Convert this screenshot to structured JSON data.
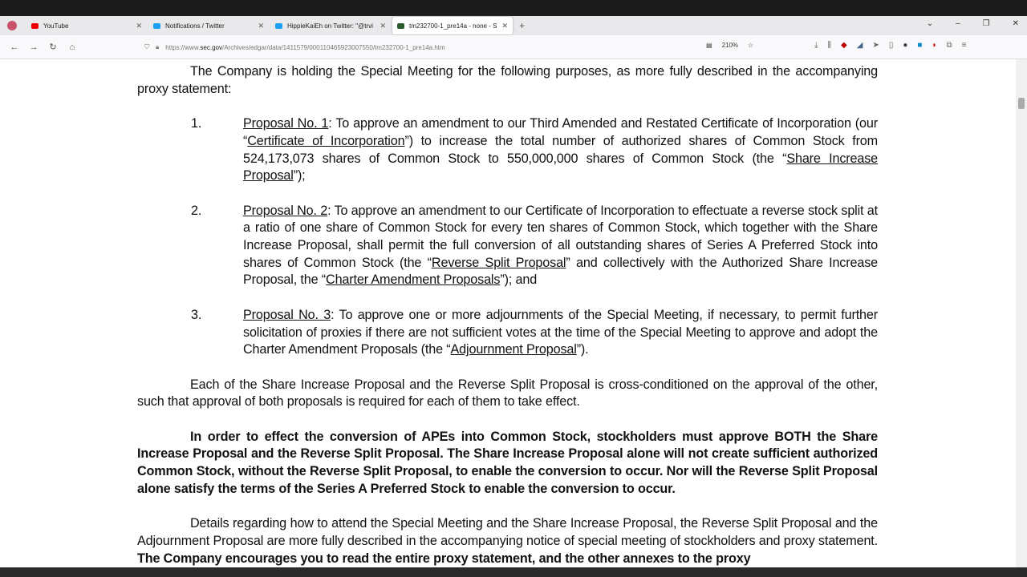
{
  "browser": {
    "tabs": [
      {
        "label": "YouTube",
        "icon": "youtube-icon",
        "color": "#e00"
      },
      {
        "label": "Notifications / Twitter",
        "icon": "twitter-icon",
        "color": "#1da1f2"
      },
      {
        "label": "HippieKaiEh on Twitter: \"@trvi",
        "icon": "twitter-icon",
        "color": "#1da1f2"
      },
      {
        "label": "tm232700-1_pre14a - none - S",
        "icon": "sec-icon",
        "color": "#2a5a2a",
        "active": true
      }
    ],
    "url_prefix": "https://www.",
    "url_domain": "sec.gov",
    "url_path": "/Archives/edgar/data/1411579/000110465923007550/tm232700-1_pre14a.htm",
    "zoom": "210%"
  },
  "document": {
    "paragraphs": [
      {
        "type": "para",
        "indent": true,
        "segs": [
          {
            "t": "The Company is holding the Special Meeting for the following purposes, as more fully described in the accompanying proxy statement:"
          }
        ]
      },
      {
        "type": "item",
        "num": "1.",
        "segs": [
          {
            "t": "Proposal No. 1",
            "u": true
          },
          {
            "t": ": To approve an amendment to our Third Amended and Restated Certificate of Incorporation (our “"
          },
          {
            "t": "Certificate of Incorporation",
            "u": true
          },
          {
            "t": "”) to increase the total number of authorized shares of Common Stock from 524,173,073 shares of Common Stock to 550,000,000 shares of Common Stock (the “"
          },
          {
            "t": "Share Increase Proposal",
            "u": true
          },
          {
            "t": "”);"
          }
        ]
      },
      {
        "type": "item",
        "num": "2.",
        "segs": [
          {
            "t": "Proposal No. 2",
            "u": true
          },
          {
            "t": ": To approve an amendment to our Certificate of Incorporation to effectuate a reverse stock split at a ratio of one share of Common Stock for every ten shares of Common Stock, which together with the Share Increase Proposal, shall permit the full conversion of all outstanding shares of Series A Preferred Stock into shares of Common Stock (the “"
          },
          {
            "t": "Reverse Split Proposal",
            "u": true
          },
          {
            "t": "” and collectively with the Authorized Share Increase Proposal, the “"
          },
          {
            "t": "Charter Amendment Proposals",
            "u": true
          },
          {
            "t": "”); and"
          }
        ]
      },
      {
        "type": "item",
        "num": "3.",
        "segs": [
          {
            "t": "Proposal No. 3",
            "u": true
          },
          {
            "t": ": To approve one or more adjournments of the Special Meeting, if necessary, to permit further solicitation of proxies if there are not sufficient votes at the time of the Special Meeting to approve and adopt the Charter Amendment Proposals (the “"
          },
          {
            "t": "Adjournment Proposal",
            "u": true
          },
          {
            "t": "”)."
          }
        ]
      },
      {
        "type": "para",
        "indent": true,
        "segs": [
          {
            "t": "Each of the Share Increase Proposal and the Reverse Split Proposal is cross-conditioned on the approval of the other, such that approval of both proposals is required for each of them to take effect."
          }
        ]
      },
      {
        "type": "para",
        "indent": true,
        "segs": [
          {
            "t": "In order to effect the conversion of APEs into Common Stock, stockholders must approve BOTH the Share Increase Proposal and the Reverse Split Proposal. The Share Increase Proposal alone will not create sufficient authorized Common Stock, without the Reverse Split Proposal, to enable the conversion to occur. Nor will the Reverse Split Proposal alone satisfy the terms of the Series  A Preferred Stock to enable the conversion to occur.",
            "b": true
          }
        ]
      },
      {
        "type": "para",
        "indent": true,
        "segs": [
          {
            "t": "Details regarding how to attend the Special Meeting and the Share Increase Proposal, the Reverse Split Proposal and the Adjournment Proposal are more fully described in the accompanying notice of special meeting of stockholders and proxy statement. "
          },
          {
            "t": "The Company encourages you to read the entire proxy statement, and the other annexes to the proxy",
            "b": true
          }
        ]
      }
    ]
  }
}
